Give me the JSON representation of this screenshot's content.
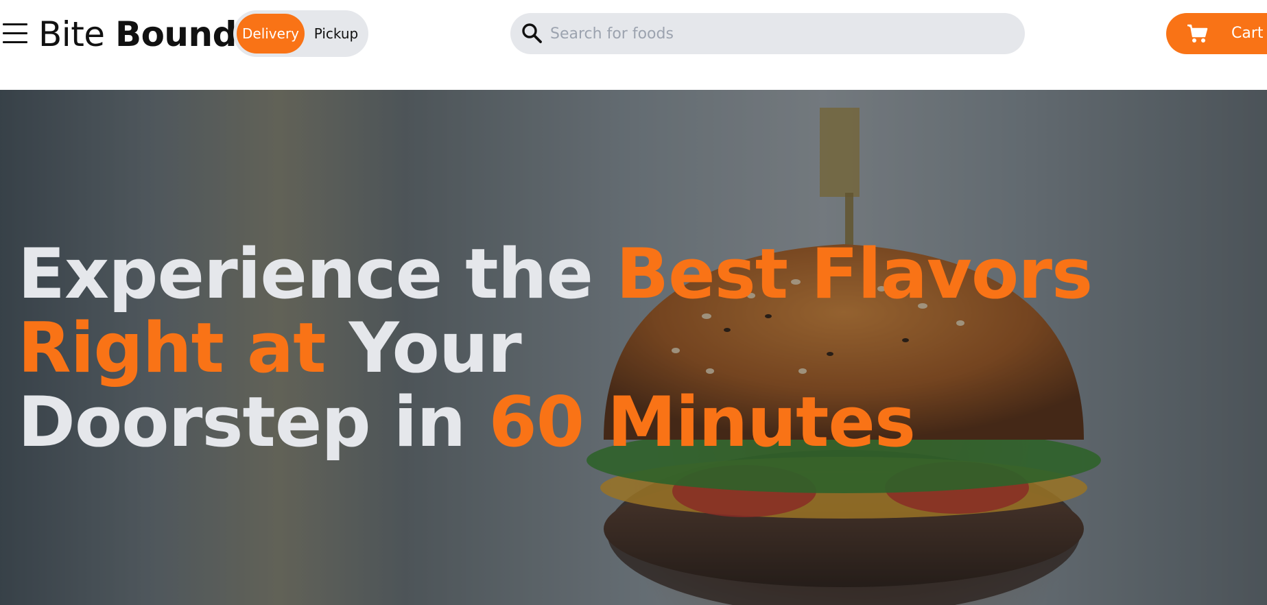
{
  "header": {
    "logo": {
      "part1": "Bite",
      "part2": "Bound"
    },
    "mode_toggle": {
      "options": [
        "Delivery",
        "Pickup"
      ],
      "selected": "Delivery"
    },
    "search": {
      "placeholder": "Search for foods",
      "value": ""
    },
    "cart": {
      "label": "Cart"
    }
  },
  "hero": {
    "line1": {
      "white": "Experience the",
      "accent": "Best Flavors"
    },
    "line2": {
      "accent": "Right at",
      "white": "Your"
    },
    "line3": {
      "white": "Doorstep in",
      "accent": "60 Minutes"
    }
  },
  "colors": {
    "accent": "#f97316",
    "hero_text": "#e5e7eb",
    "toggle_bg": "#e5e7eb"
  },
  "icons": {
    "menu": "hamburger-menu-icon",
    "search": "search-icon",
    "cart": "cart-icon"
  }
}
